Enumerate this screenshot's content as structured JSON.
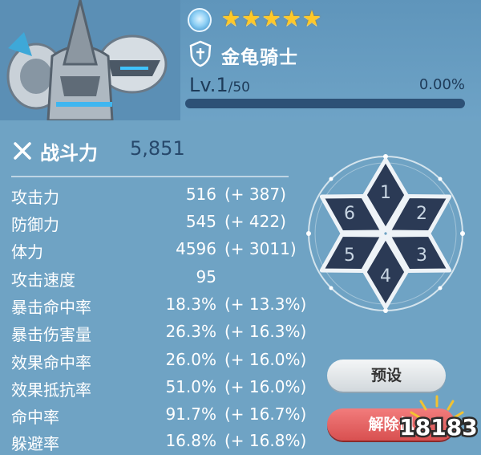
{
  "hero": {
    "name": "金龟骑士",
    "stars": 5,
    "star_glyph": "★",
    "element_icon": "water-element-icon",
    "class_icon": "shield-class-icon",
    "level_prefix": "Lv.",
    "level": "1",
    "level_max": "/50",
    "exp_percent": "0.00%",
    "exp_fraction": 0.0
  },
  "combat_power": {
    "label": "战斗力",
    "value": "5,851",
    "icon": "crossed-swords-icon"
  },
  "stats": [
    {
      "label": "攻击力",
      "value": "516",
      "bonus": "(+ 387)"
    },
    {
      "label": "防御力",
      "value": "545",
      "bonus": "(+ 422)"
    },
    {
      "label": "体力",
      "value": "4596",
      "bonus": "(+ 3011)"
    },
    {
      "label": "攻击速度",
      "value": "95",
      "bonus": ""
    },
    {
      "label": "暴击命中率",
      "value": "18.3%",
      "bonus": "(+ 13.3%)"
    },
    {
      "label": "暴击伤害量",
      "value": "26.3%",
      "bonus": "(+ 16.3%)"
    },
    {
      "label": "效果命中率",
      "value": "26.0%",
      "bonus": "(+ 16.0%)"
    },
    {
      "label": "效果抵抗率",
      "value": "51.0%",
      "bonus": "(+ 16.0%)"
    },
    {
      "label": "命中率",
      "value": "91.7%",
      "bonus": "(+ 16.7%)"
    },
    {
      "label": "躲避率",
      "value": "16.8%",
      "bonus": "(+ 16.8%)"
    }
  ],
  "rune_slots": [
    "1",
    "2",
    "3",
    "4",
    "5",
    "6"
  ],
  "buttons": {
    "preset": "预设",
    "unequip": "解除佩"
  },
  "watermark": "18183",
  "colors": {
    "star": "#ffc928",
    "slot_fill": "#2b3a55",
    "unequip": "#e06060",
    "background": "#6fa3c4"
  }
}
